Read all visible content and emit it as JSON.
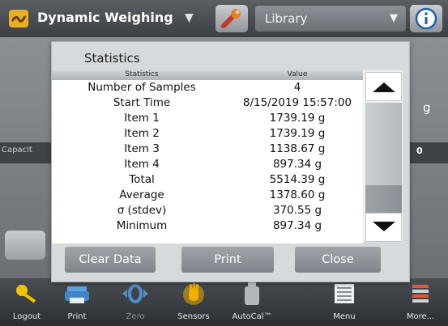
{
  "topbar": {
    "app_title": "Dynamic Weighing",
    "library_label": "Library"
  },
  "background": {
    "capacity_label": "Capacit",
    "unit_label": "g",
    "value_label": "0"
  },
  "dialog": {
    "title": "Statistics",
    "columns": [
      "Statistics",
      "Value"
    ],
    "rows": [
      {
        "label": "Number of Samples",
        "value": "4"
      },
      {
        "label": "Start Time",
        "value": "8/15/2019 15:57:00"
      },
      {
        "label": "Item 1",
        "value": "1739.19 g"
      },
      {
        "label": "Item 2",
        "value": "1739.19 g"
      },
      {
        "label": "Item 3",
        "value": "1138.67 g"
      },
      {
        "label": "Item 4",
        "value": "897.34 g"
      },
      {
        "label": "Total",
        "value": "5514.39 g"
      },
      {
        "label": "Average",
        "value": "1378.60 g"
      },
      {
        "label": "σ (stdev)",
        "value": "370.55 g"
      },
      {
        "label": "Minimum",
        "value": "897.34 g"
      }
    ],
    "buttons": {
      "clear": "Clear Data",
      "print": "Print",
      "close": "Close"
    }
  },
  "bottombar": [
    {
      "label": "Logout",
      "icon": "key-icon"
    },
    {
      "label": "Print",
      "icon": "printer-icon"
    },
    {
      "label": "Zero",
      "icon": "zero-icon"
    },
    {
      "label": "Sensors",
      "icon": "hand-sensor-icon"
    },
    {
      "label": "AutoCal™",
      "icon": "calibration-weight-icon"
    },
    {
      "label": "Menu",
      "icon": "menu-icon"
    },
    {
      "label": "More...",
      "icon": "more-icon"
    }
  ]
}
